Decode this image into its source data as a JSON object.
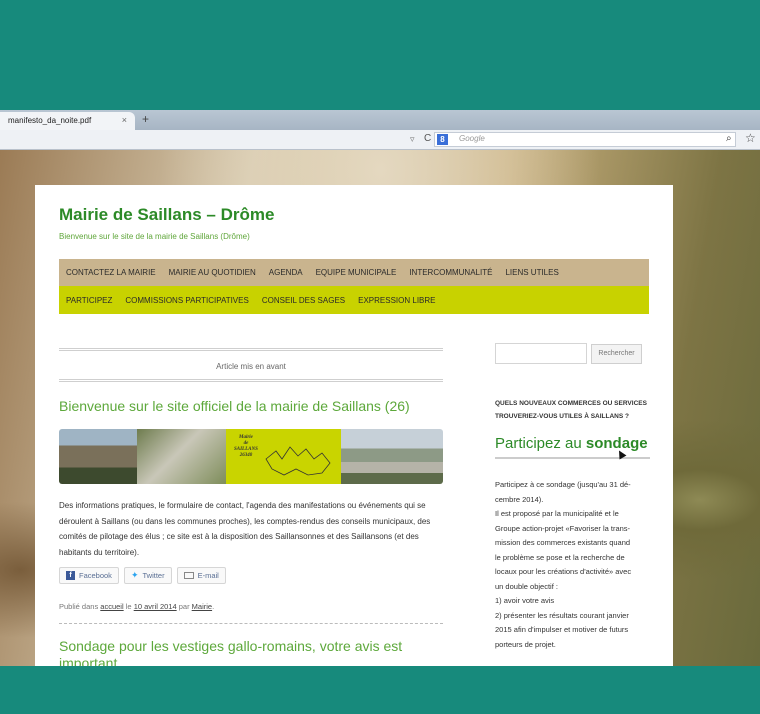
{
  "browser": {
    "tab_title": "manifesto_da_noite.pdf",
    "tab_close": "×",
    "new_tab": "+",
    "search_placeholder": "Google"
  },
  "site": {
    "title": "Mairie de Saillans – Drôme",
    "description": "Bienvenue sur le site de la mairie de Saillans (Drôme)",
    "menu_primary": [
      "CONTACTEZ LA MAIRIE",
      "MAIRIE AU QUOTIDIEN",
      "AGENDA",
      "EQUIPE MUNICIPALE",
      "INTERCOMMUNALITÉ",
      "LIENS UTILES"
    ],
    "menu_secondary": [
      "PARTICIPEZ",
      "COMMISSIONS PARTICIPATIVES",
      "CONSEIL DES SAGES",
      "EXPRESSION LIBRE"
    ]
  },
  "main": {
    "featured_label": "Article mis en avant",
    "post_title": "Bienvenue sur le site officiel de la mairie de Saillans (26)",
    "banner_logo": [
      "Mairie",
      "de",
      "SAILLANS",
      "26340"
    ],
    "post_body": "Des informations pratiques, le formulaire de contact, l'agenda des manifestations ou événements qui se déroulent à Saillans (ou dans les communes proches), les comptes-rendus des conseils municipaux, des comités de pilotage des élus ; ce site est à la disposition des Saillansonnes et des Saillansons (et des habitants du territoire).",
    "share": {
      "facebook": "Facebook",
      "twitter": "Twitter",
      "email": "E-mail"
    },
    "meta": {
      "prefix": "Publié dans",
      "category": "accueil",
      "on": "le",
      "date": "10 avril 2014",
      "by": "par",
      "author": "Mairie",
      "end": "."
    },
    "post_title_2": "Sondage pour les vestiges gallo-romains, votre avis est important"
  },
  "sidebar": {
    "search_button": "Rechercher",
    "heading": "QUELS NOUVEAUX COMMERCES OU SERVICES TROUVERIEZ-VOUS UTILES À SAILLANS ?",
    "sondage_prefix": "Participez au",
    "sondage_bold": "sondage",
    "text_lines": [
      "Participez à ce sondage (jusqu'au 31 dé-",
      "cembre 2014).",
      "Il est proposé par la municipalité et le",
      "Groupe action-projet «Favoriser la trans-",
      "mission des commerces existants quand",
      "le problème se pose et la recherche de",
      "locaux pour les créations d'activité» avec",
      "un double objectif :",
      "1) avoir votre avis",
      "2) présenter les résultats courant janvier",
      "2015 afin d'impulser et motiver de futurs",
      "porteurs de projet."
    ]
  }
}
